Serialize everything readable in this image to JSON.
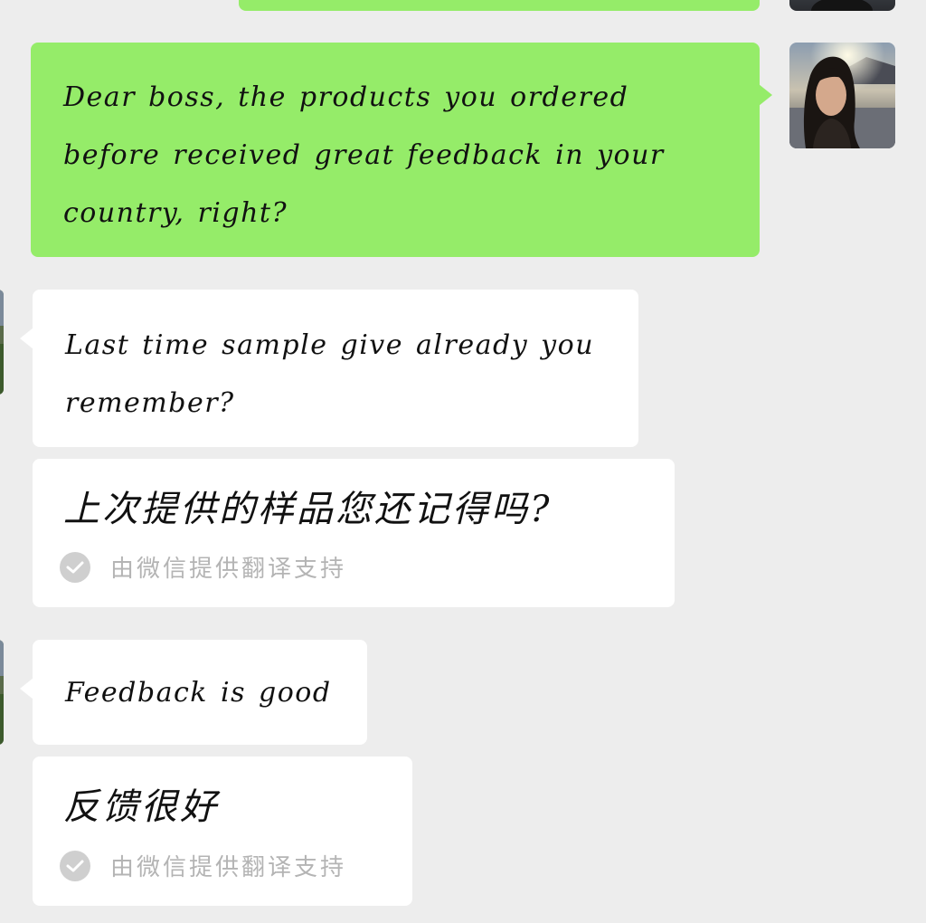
{
  "colors": {
    "background": "#ededed",
    "sent_bubble": "#95ec69",
    "received_bubble": "#ffffff",
    "translation_meta": "#b4b4b4"
  },
  "messages": {
    "sent": {
      "text": "Dear boss, the products you ordered before received great feedback in your country, right?"
    },
    "received_1": {
      "text": "Last time sample give already you remember?",
      "translation": "上次提供的样品您还记得吗?",
      "translation_label": "由微信提供翻译支持"
    },
    "received_2": {
      "text": "Feedback is good",
      "translation": "反馈很好",
      "translation_label": "由微信提供翻译支持"
    }
  }
}
